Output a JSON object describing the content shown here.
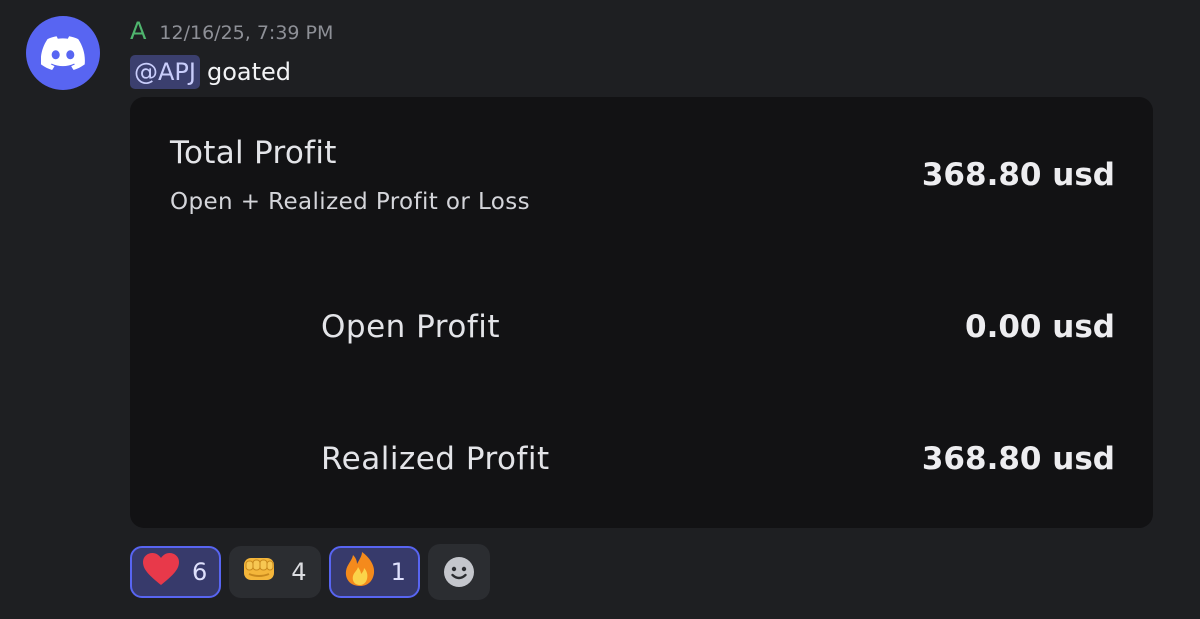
{
  "message": {
    "username": "A",
    "timestamp": "12/16/25, 7:39 PM",
    "mention": "@APJ",
    "text": "goated"
  },
  "embed": {
    "total_label": "Total Profit",
    "total_subtitle": "Open + Realized Profit or Loss",
    "total_value": "368.80 usd",
    "open_label": "Open Profit",
    "open_value": "0.00 usd",
    "realized_label": "Realized Profit",
    "realized_value": "368.80 usd"
  },
  "reactions": [
    {
      "emoji": "heart-emoji",
      "count": "6",
      "active": true
    },
    {
      "emoji": "oncoming-fist-emoji",
      "count": "4",
      "active": false
    },
    {
      "emoji": "fire-emoji",
      "count": "1",
      "active": true
    }
  ],
  "colors": {
    "background": "#1e1f22",
    "username": "#4fb56e",
    "mention_bg": "#3b3f6e",
    "accent": "#5865f2",
    "embed_bg": "#121214"
  }
}
